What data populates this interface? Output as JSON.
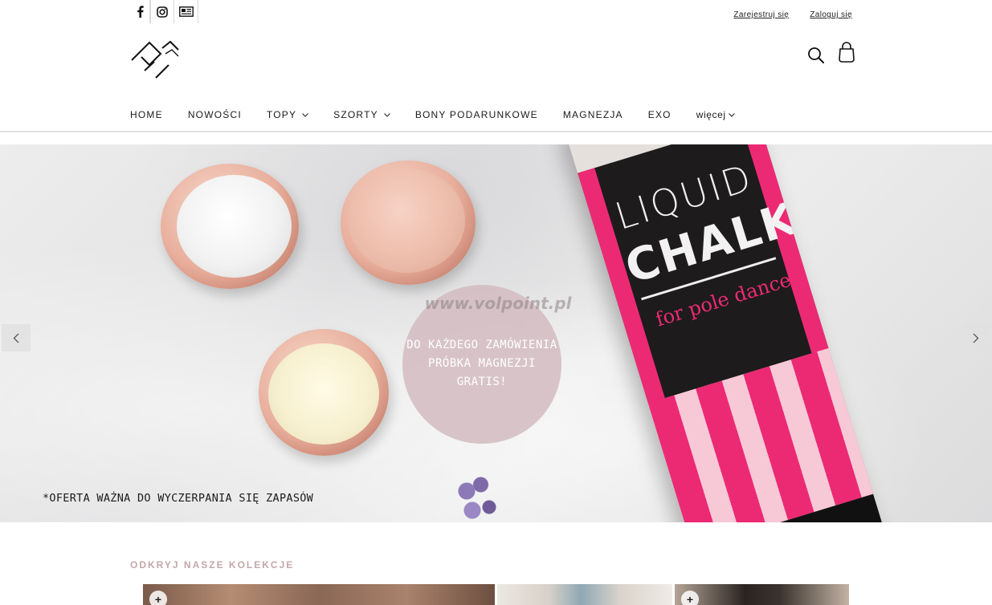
{
  "topbar": {
    "social": [
      {
        "name": "facebook-icon"
      },
      {
        "name": "instagram-icon"
      },
      {
        "name": "blog-icon"
      }
    ],
    "register_label": "Zarejestruj się",
    "login_label": "Zaloguj się"
  },
  "header": {
    "logo_icon": "pa-monogram-logo",
    "search_icon": "search-icon",
    "cart_icon": "shopping-bag-icon"
  },
  "nav": {
    "items": [
      {
        "label": "HOME",
        "has_dropdown": false
      },
      {
        "label": "NOWOŚCI",
        "has_dropdown": false
      },
      {
        "label": "TOPY",
        "has_dropdown": true
      },
      {
        "label": "SZORTY",
        "has_dropdown": true
      },
      {
        "label": "BONY PODARUNKOWE",
        "has_dropdown": false
      },
      {
        "label": "MAGNEZJA",
        "has_dropdown": false
      },
      {
        "label": "EXO",
        "has_dropdown": false
      },
      {
        "label": "więcej",
        "has_dropdown": true
      }
    ]
  },
  "hero": {
    "tube_line1": "LIQUID",
    "tube_line2": "CHALK",
    "tube_line3": "for pole dance",
    "watermark": "www.volpoint.pl",
    "promo": "DO KAŻDEGO ZAMÓWIENIA\nPRÓBKA MAGNEZJI\nGRATIS!",
    "offer_note": "*OFERTA WAŻNA DO WYCZERPANIA SIĘ ZAPASÓW",
    "prev_icon": "chevron-left-icon",
    "next_icon": "chevron-right-icon"
  },
  "collections": {
    "heading": "ODKRYJ NASZE KOLEKCJE",
    "tiles": [
      {
        "plus": "+"
      },
      {
        "plus": ""
      },
      {
        "plus": "+"
      }
    ]
  },
  "colors": {
    "accent_heading": "#c3a8a9",
    "tube_pink": "#ec2a73",
    "promo_circle": "#d2babe"
  }
}
